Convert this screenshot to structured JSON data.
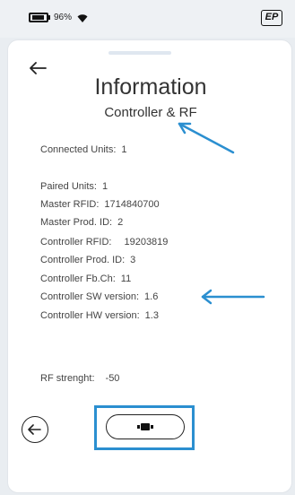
{
  "status": {
    "battery_percent": "96%",
    "battery_icon": "battery-icon",
    "wifi_icon": "wifi-icon",
    "brand_logo": "EP"
  },
  "header": {
    "title": "Information",
    "subtitle": "Controller & RF"
  },
  "info": {
    "connected_units": {
      "label": "Connected Units:",
      "value": "1"
    },
    "paired_units": {
      "label": "Paired Units:",
      "value": "1"
    },
    "master_rfid": {
      "label": "Master RFID:",
      "value": "1714840700"
    },
    "master_prod_id": {
      "label": "Master Prod. ID:",
      "value": "2"
    },
    "controller_rfid": {
      "label": "Controller RFID:",
      "value": "19203819"
    },
    "controller_prod_id": {
      "label": "Controller Prod. ID:",
      "value": "3"
    },
    "controller_fb_ch": {
      "label": "Controller Fb.Ch:",
      "value": "11"
    },
    "controller_sw_version": {
      "label": "Controller SW version:",
      "value": "1.6"
    },
    "controller_hw_version": {
      "label": "Controller HW version:",
      "value": "1.3"
    },
    "rf_strength": {
      "label": "RF strenght:",
      "value": "-50"
    }
  },
  "icons": {
    "back_top": "back-arrow-icon",
    "back_round": "back-arrow-circle-icon",
    "connector": "connector-icon"
  },
  "colors": {
    "annotation_blue": "#2b8fd0",
    "text": "#333333"
  }
}
